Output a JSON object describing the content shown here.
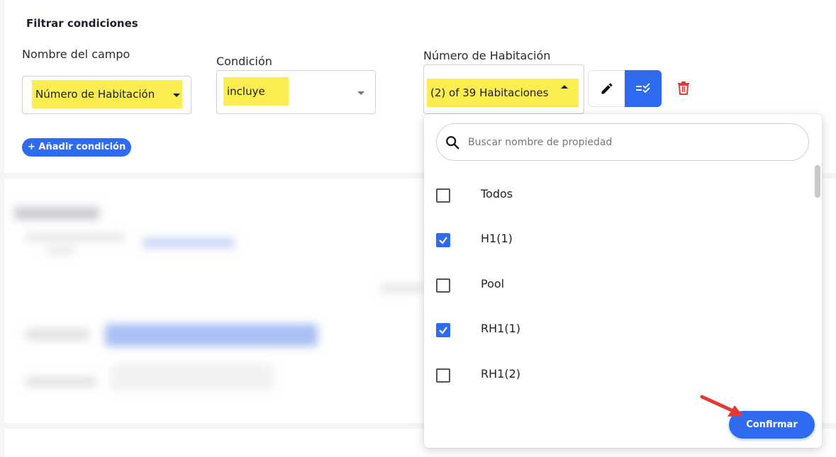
{
  "filters": {
    "title": "Filtrar condiciones",
    "field_name": {
      "label": "Nombre del campo",
      "value": "Número de Habitación"
    },
    "condition": {
      "label": "Condición",
      "value": "incluye"
    },
    "room_number": {
      "label": "Número de Habitación",
      "value": "(2) of 39 Habitaciones"
    },
    "add_condition": "+ Añadir condición",
    "icons": {
      "edit": "pencil-icon",
      "select_list": "list-check-icon",
      "delete": "trash-icon"
    }
  },
  "dropdown": {
    "search_placeholder": "Buscar nombre de propiedad",
    "options": [
      {
        "label": "Todos",
        "checked": false
      },
      {
        "label": "H1(1)",
        "checked": true
      },
      {
        "label": "Pool",
        "checked": false
      },
      {
        "label": "RH1(1)",
        "checked": true
      },
      {
        "label": "RH1(2)",
        "checked": false
      }
    ],
    "confirm_label": "Confirmar"
  },
  "colors": {
    "accent": "#2f6bf0",
    "highlight": "#fbec4f",
    "delete": "#e53935",
    "arrow": "#e53935"
  }
}
